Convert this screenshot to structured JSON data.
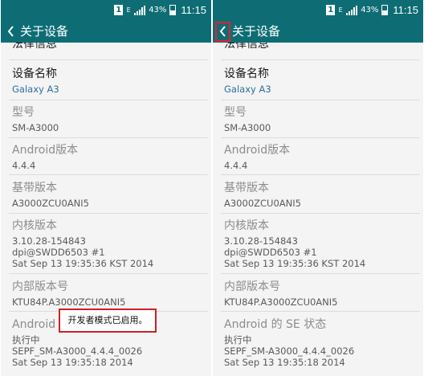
{
  "status_bar": {
    "notification_glyph": "1",
    "network_type": "E",
    "battery_percent": "43%",
    "time": "11:15"
  },
  "action_bar": {
    "title": "关于设备"
  },
  "items": {
    "legal": {
      "title": "法律信息"
    },
    "device_name": {
      "title": "设备名称",
      "value": "Galaxy A3"
    },
    "model": {
      "title": "型号",
      "value": "SM-A3000"
    },
    "android_version": {
      "title": "Android版本",
      "value": "4.4.4"
    },
    "baseband": {
      "title": "基带版本",
      "value": "A3000ZCU0ANI5"
    },
    "kernel": {
      "title": "内核版本",
      "lines": [
        "3.10.28-154843",
        "dpi@SWDD6503 #1",
        "Sat Sep 13 19:35:36 KST 2014"
      ]
    },
    "build_number": {
      "title": "内部版本号",
      "value": "KTU84P.A3000ZCU0ANI5"
    },
    "se_status_left": {
      "title_visible": "Android",
      "lines": [
        "执行中",
        "SEPF_SM-A3000_4.4.4_0026",
        "Sat Sep 13 19:35:18 2014"
      ]
    },
    "se_status_right": {
      "title": "Android 的 SE 状态",
      "lines": [
        "执行中",
        "SEPF_SM-A3000_4.4.4_0026",
        "Sat Sep 13 19:35:18 2014"
      ]
    }
  },
  "toast": {
    "message": "开发者模式已启用。"
  },
  "colors": {
    "action_bar": "#0e6d74",
    "highlight": "#e3212a",
    "value_blue": "#2e6f9f",
    "muted_title": "#8c8c8c"
  },
  "icons": {
    "back": "chevron-left-icon",
    "signal": "signal-icon",
    "battery": "battery-icon",
    "notification": "notification-icon"
  }
}
